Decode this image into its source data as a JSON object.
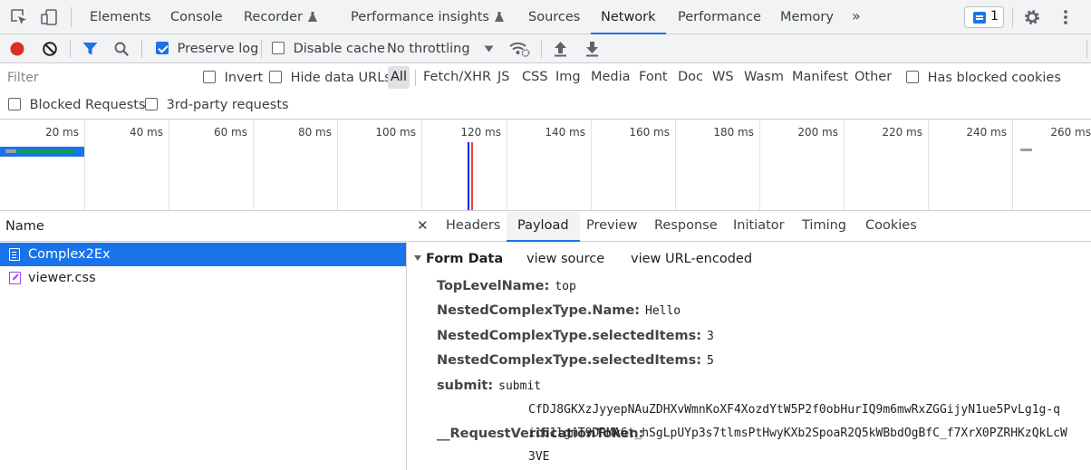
{
  "tabbar": {
    "tabs": [
      {
        "label": "Elements"
      },
      {
        "label": "Console"
      },
      {
        "label": "Recorder"
      },
      {
        "label": "Performance insights"
      },
      {
        "label": "Sources"
      },
      {
        "label": "Network",
        "active": true
      },
      {
        "label": "Performance"
      },
      {
        "label": "Memory"
      }
    ],
    "overflow": "»",
    "issues_count": "1",
    "icons": [
      "inspect-element-icon",
      "device-toolbar-icon",
      "flask-icon",
      "message-icon",
      "gear-icon",
      "more-vert-icon"
    ]
  },
  "toolbar": {
    "preserve_log": {
      "label": "Preserve log",
      "checked": true
    },
    "disable_cache": {
      "label": "Disable cache",
      "checked": false
    },
    "throttling": "No throttling",
    "icons": [
      "record-icon",
      "clear-icon",
      "filter-icon",
      "search-icon",
      "dropdown-caret-icon",
      "network-conditions-icon",
      "upload-icon",
      "download-icon"
    ]
  },
  "filter": {
    "placeholder": "Filter",
    "invert": "Invert",
    "hide_data_urls": "Hide data URLs",
    "types": [
      "All",
      "Fetch/XHR",
      "JS",
      "CSS",
      "Img",
      "Media",
      "Font",
      "Doc",
      "WS",
      "Wasm",
      "Manifest",
      "Other"
    ],
    "active_type": "All",
    "has_blocked_cookies": "Has blocked cookies",
    "blocked_requests": "Blocked Requests",
    "third_party": "3rd-party requests"
  },
  "overview": {
    "ticks": [
      "20 ms",
      "40 ms",
      "60 ms",
      "80 ms",
      "100 ms",
      "120 ms",
      "140 ms",
      "160 ms",
      "180 ms",
      "200 ms",
      "220 ms",
      "240 ms",
      "260 ms"
    ],
    "colors": {
      "dom_content_loaded": "#1a1aff",
      "load": "#e8453c",
      "waiting": "#0f9d58",
      "queued": "#9aa0a6"
    }
  },
  "requests": {
    "column": "Name",
    "rows": [
      {
        "name": "Complex2Ex",
        "type": "document",
        "selected": true
      },
      {
        "name": "viewer.css",
        "type": "stylesheet",
        "selected": false
      }
    ]
  },
  "details": {
    "tabs": [
      "Headers",
      "Payload",
      "Preview",
      "Response",
      "Initiator",
      "Timing",
      "Cookies"
    ],
    "active_tab": "Payload",
    "section_title": "Form Data",
    "view_source": "view source",
    "view_url_encoded": "view URL-encoded",
    "fields": [
      {
        "key": "TopLevelName:",
        "value": "top"
      },
      {
        "key": "NestedComplexType.Name:",
        "value": "Hello"
      },
      {
        "key": "NestedComplexType.selectedItems:",
        "value": "3"
      },
      {
        "key": "NestedComplexType.selectedItems:",
        "value": "5"
      },
      {
        "key": "submit:",
        "value": "submit"
      }
    ],
    "token_key": "__RequestVerificationToken:",
    "token_lines": [
      "CfDJ8GKXzJyyepNAuZDHXvWmnKoXF4XozdYtW5P2f0obHurIQ9m6mwRxZGGijyN1ue5PvLg1g-q",
      "icu1lgmT9DRMA6t_hSgLpUYp3s7tlmsPtHwyKXb2SpoaR2Q5kWBbdOgBfC_f7XrX0PZRHKzQkLcW",
      "3VE"
    ]
  }
}
